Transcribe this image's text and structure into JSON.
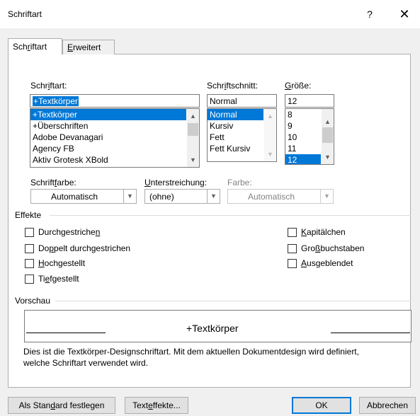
{
  "dialog": {
    "title": "Schriftart",
    "help_label": "?",
    "close_label": "✕"
  },
  "tabs": [
    {
      "label_pre": "Sch",
      "label_key": "r",
      "label_post": "iftart"
    },
    {
      "label_pre": "",
      "label_key": "E",
      "label_post": "rweitert"
    }
  ],
  "font": {
    "label_pre": "Schr",
    "label_key": "i",
    "label_post": "ftart:",
    "value": "+Textkörper",
    "items": [
      "+Textkörper",
      "+Überschriften",
      "Adobe Devanagari",
      "Agency FB",
      "Aktiv Grotesk XBold"
    ]
  },
  "style": {
    "label_pre": "Schr",
    "label_key": "i",
    "label_post": "ftschnitt:",
    "value": "Normal",
    "items": [
      "Normal",
      "Kursiv",
      "Fett",
      "Fett Kursiv"
    ]
  },
  "size": {
    "label_pre": "",
    "label_key": "G",
    "label_post": "röße:",
    "value": "12",
    "items": [
      "8",
      "9",
      "10",
      "11",
      "12"
    ]
  },
  "font_color": {
    "label_pre": "Schrift",
    "label_key": "f",
    "label_post": "arbe:",
    "value": "Automatisch"
  },
  "underline": {
    "label_pre": "",
    "label_key": "U",
    "label_post": "nterstreichung:",
    "value": "(ohne)"
  },
  "underline_color": {
    "label": "Farbe:",
    "value": "Automatisch"
  },
  "effects": {
    "heading": "Effekte",
    "left": [
      {
        "pre": "Durchgestriche",
        "key": "n",
        "post": ""
      },
      {
        "pre": "Do",
        "key": "p",
        "post": "pelt durchgestrichen"
      },
      {
        "pre": "",
        "key": "H",
        "post": "ochgestellt"
      },
      {
        "pre": "Ti",
        "key": "e",
        "post": "fgestellt"
      }
    ],
    "right": [
      {
        "pre": "",
        "key": "K",
        "post": "apitälchen"
      },
      {
        "pre": "Gro",
        "key": "ß",
        "post": "buchstaben"
      },
      {
        "pre": "",
        "key": "A",
        "post": "usgeblendet"
      }
    ]
  },
  "preview": {
    "heading": "Vorschau",
    "sample": "+Textkörper",
    "description_line1": "Dies ist die Textkörper-Designschriftart. Mit dem aktuellen Dokumentdesign wird definiert,",
    "description_line2": "welche Schriftart verwendet wird."
  },
  "buttons": {
    "default": {
      "pre": "Als Stan",
      "key": "d",
      "post": "ard festlegen"
    },
    "text_effects": {
      "pre": "Text",
      "key": "e",
      "post": "ffekte..."
    },
    "ok": "OK",
    "cancel": "Abbrechen"
  },
  "icons": {
    "scroll_up": "▲",
    "scroll_down": "▼",
    "dropdown": "▼"
  }
}
